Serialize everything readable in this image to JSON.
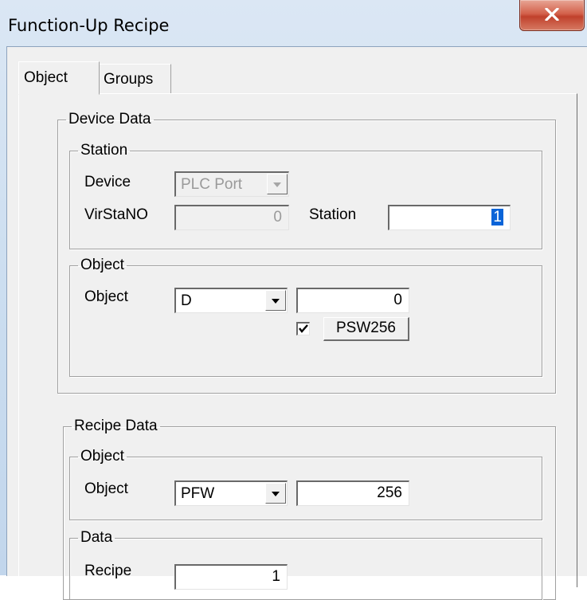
{
  "window": {
    "title": "Function-Up Recipe"
  },
  "tabs": [
    {
      "label": "Object"
    },
    {
      "label": "Groups"
    }
  ],
  "device_data": {
    "legend": "Device Data",
    "station": {
      "legend": "Station",
      "device_label": "Device",
      "device_value": "PLC Port",
      "virstano_label": "VirStaNO",
      "virstano_value": "0",
      "station_label": "Station",
      "station_value": "1"
    },
    "object": {
      "legend": "Object",
      "object_label": "Object",
      "object_type": "D",
      "object_value": "0",
      "checkbox_checked": true,
      "psw_button": "PSW256"
    }
  },
  "recipe_data": {
    "legend": "Recipe Data",
    "object": {
      "legend": "Object",
      "object_label": "Object",
      "object_type": "PFW",
      "object_value": "256"
    },
    "data": {
      "legend": "Data",
      "recipe_label": "Recipe",
      "recipe_value": "1"
    }
  },
  "icons": {
    "close": "close-icon",
    "check": "check-icon",
    "dropdown": "chevron-down-icon"
  }
}
